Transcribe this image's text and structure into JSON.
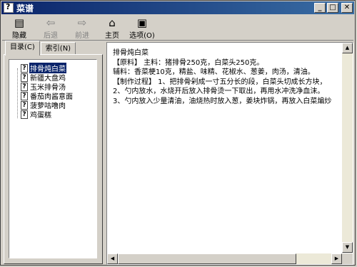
{
  "window": {
    "title": "菜谱"
  },
  "toolbar": {
    "hide_label": "隐藏",
    "back_label": "后退",
    "forward_label": "前进",
    "home_label": "主页",
    "options_label": "选项(O)"
  },
  "tabs": [
    {
      "label": "目录(C)"
    },
    {
      "label": "索引(N)"
    }
  ],
  "tree": [
    {
      "label": "排骨炖白菜",
      "selected": true
    },
    {
      "label": "新疆大盘鸡"
    },
    {
      "label": "玉米排骨汤"
    },
    {
      "label": "番茄肉酱意面"
    },
    {
      "label": "菠萝咕噜肉"
    },
    {
      "label": "鸡蛋糕"
    }
  ],
  "content": {
    "lines": [
      "排骨炖白菜",
      "【原料】 主料：猪排骨250克，白菜头250克。",
      "辅料：香菜梗10克，精盐、味精、花椒水、葱姜，肉汤，清油。",
      "【制作过程】 1、把排骨剁成一寸五分长的段，白菜头切成长方块，",
      "2、勺内放水，水烧开后放入排骨烫一下取出，再用水冲洗净血沫。",
      "3、勺内放入少量清油，油烧热时放入葱，姜块炸锅，再放入白菜煸炒"
    ]
  },
  "icons": {
    "hide": "hide-icon",
    "back": "back-arrow-icon",
    "forward": "forward-arrow-icon",
    "home": "home-icon",
    "options": "options-icon"
  }
}
